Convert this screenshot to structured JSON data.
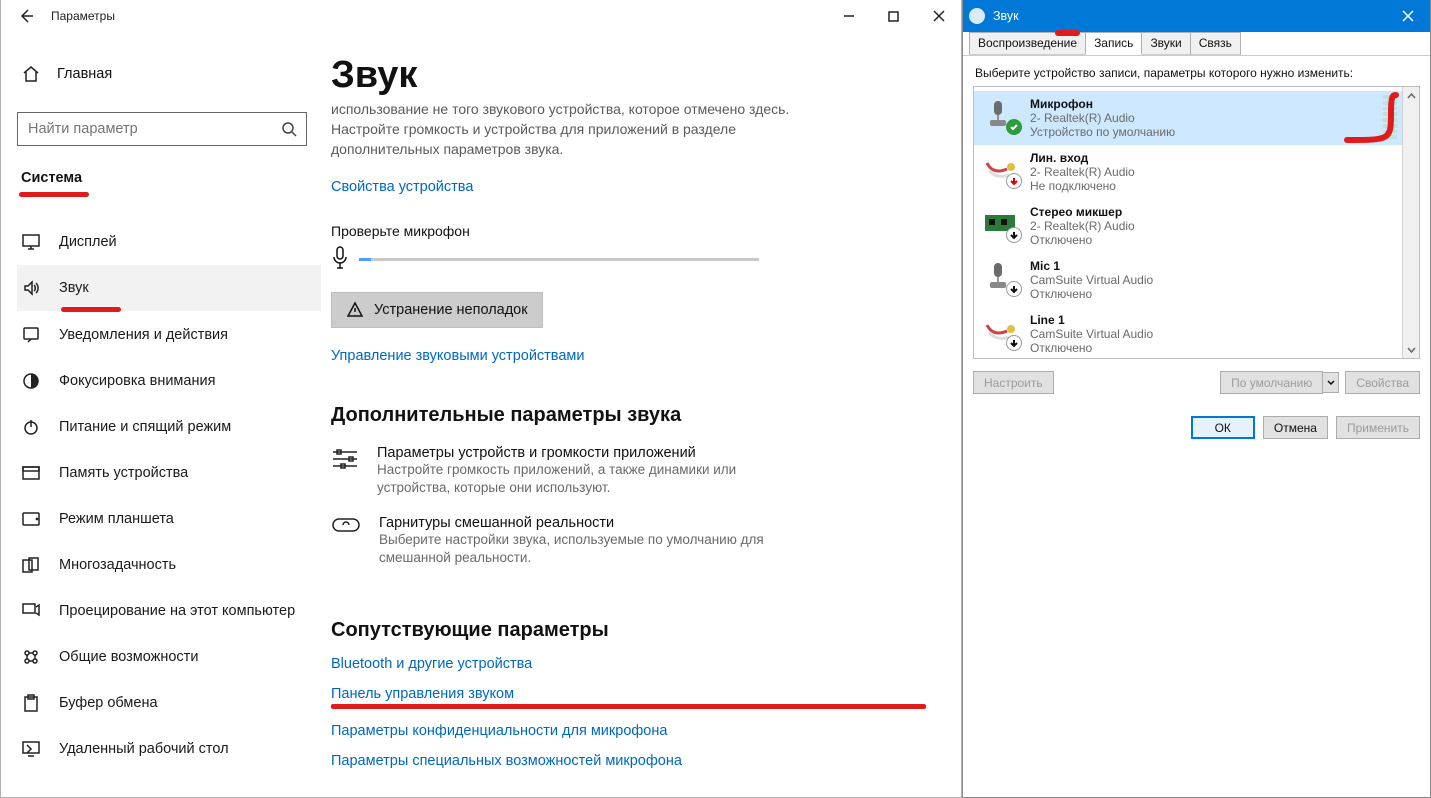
{
  "settings": {
    "window_title": "Параметры",
    "home_label": "Главная",
    "search_placeholder": "Найти параметр",
    "section_label": "Система",
    "nav": [
      {
        "icon": "display",
        "label": "Дисплей"
      },
      {
        "icon": "sound",
        "label": "Звук",
        "active": true
      },
      {
        "icon": "notify",
        "label": "Уведомления и действия"
      },
      {
        "icon": "focus",
        "label": "Фокусировка внимания"
      },
      {
        "icon": "power",
        "label": "Питание и спящий режим"
      },
      {
        "icon": "storage",
        "label": "Память устройства"
      },
      {
        "icon": "tablet",
        "label": "Режим планшета"
      },
      {
        "icon": "multitask",
        "label": "Многозадачность"
      },
      {
        "icon": "project",
        "label": "Проецирование на этот компьютер"
      },
      {
        "icon": "shared",
        "label": "Общие возможности"
      },
      {
        "icon": "clipboard",
        "label": "Буфер обмена"
      },
      {
        "icon": "remote",
        "label": "Удаленный рабочий стол"
      }
    ],
    "main": {
      "heading": "Звук",
      "intro_grey": "использование не того звукового устройства, которое отмечено здесь. Настройте громкость и устройства для приложений в разделе дополнительных параметров звука.",
      "device_props_link": "Свойства устройства",
      "check_mic_label": "Проверьте микрофон",
      "troubleshoot_label": "Устранение неполадок",
      "manage_devices_link": "Управление звуковыми устройствами",
      "advanced_heading": "Дополнительные параметры звука",
      "adv1_title": "Параметры устройств и громкости приложений",
      "adv1_desc": "Настройте громкость приложений, а также динамики или устройства, которые они используют.",
      "adv2_title": "Гарнитуры смешанной реальности",
      "adv2_desc": "Выберите настройки звука, используемые по умолчанию для смешанной реальности.",
      "related_heading": "Сопутствующие параметры",
      "links": [
        "Bluetooth и другие устройства",
        "Панель управления звуком",
        "Параметры конфиденциальности для микрофона",
        "Параметры специальных возможностей микрофона"
      ]
    }
  },
  "sound_dialog": {
    "title": "Звук",
    "tabs": [
      "Воспроизведение",
      "Запись",
      "Звуки",
      "Связь"
    ],
    "active_tab_index": 1,
    "instruction": "Выберите устройство записи, параметры которого нужно изменить:",
    "devices": [
      {
        "selected": true,
        "name": "Микрофон",
        "line2": "2- Realtek(R) Audio",
        "line3": "Устройство по умолчанию",
        "overlay": "check-green"
      },
      {
        "selected": false,
        "name": "Лин. вход",
        "line2": "2- Realtek(R) Audio",
        "line3": "Не подключено",
        "overlay": "down-red"
      },
      {
        "selected": false,
        "name": "Стерео микшер",
        "line2": "2- Realtek(R) Audio",
        "line3": "Отключено",
        "overlay": "down-black"
      },
      {
        "selected": false,
        "name": "Mic 1",
        "line2": "CamSuite Virtual Audio",
        "line3": "Отключено",
        "overlay": "down-black"
      },
      {
        "selected": false,
        "name": "Line 1",
        "line2": "CamSuite Virtual Audio",
        "line3": "Отключено",
        "overlay": "down-black"
      }
    ],
    "btn_configure": "Настроить",
    "btn_default": "По умолчанию",
    "btn_props": "Свойства",
    "btn_ok": "ОК",
    "btn_cancel": "Отмена",
    "btn_apply": "Применить"
  }
}
